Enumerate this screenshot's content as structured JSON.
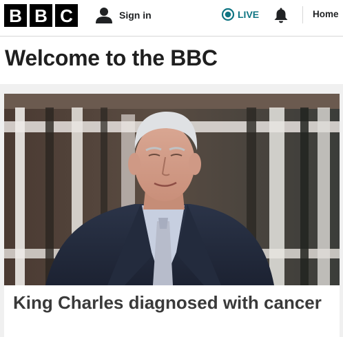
{
  "header": {
    "logo_letters": [
      "B",
      "B",
      "C"
    ],
    "signin_label": "Sign in",
    "live_label": "LIVE",
    "home_label": "Home",
    "live_color": "#0f7583"
  },
  "page": {
    "title": "Welcome to the BBC"
  },
  "story": {
    "headline": "King Charles diagnosed with cancer",
    "image_icon": "photo-portrait"
  },
  "colors": {
    "brand_black": "#000000",
    "band_grey": "#f0f0f0"
  },
  "icons": {
    "account": "user-icon",
    "live": "live-indicator-icon",
    "notifications": "bell-icon"
  }
}
